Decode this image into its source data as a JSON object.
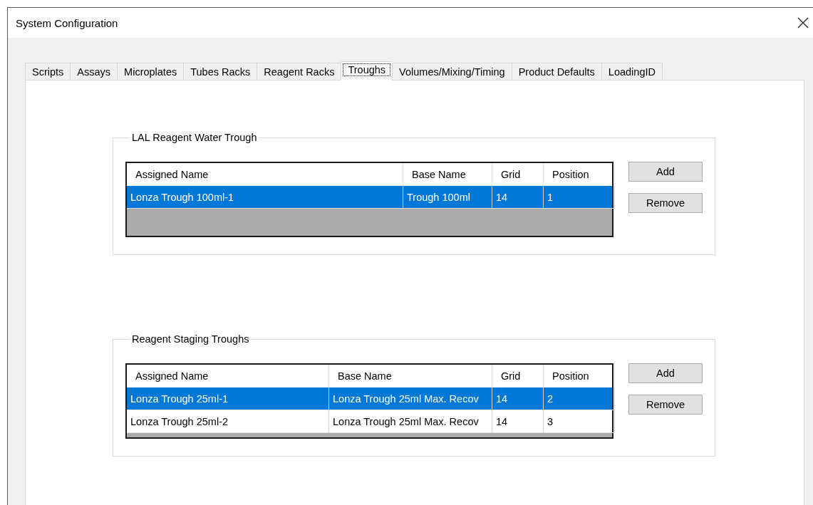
{
  "window": {
    "title": "System Configuration"
  },
  "tabs": [
    {
      "label": "Scripts",
      "selected": false
    },
    {
      "label": "Assays",
      "selected": false
    },
    {
      "label": "Microplates",
      "selected": false
    },
    {
      "label": "Tubes Racks",
      "selected": false
    },
    {
      "label": "Reagent Racks",
      "selected": false
    },
    {
      "label": "Troughs",
      "selected": true
    },
    {
      "label": "Volumes/Mixing/Timing",
      "selected": false
    },
    {
      "label": "Product Defaults",
      "selected": false
    },
    {
      "label": "LoadingID",
      "selected": false
    }
  ],
  "groups": [
    {
      "title": "LAL Reagent Water Trough",
      "columns": [
        "Assigned Name",
        "Base Name",
        "Grid",
        "Position"
      ],
      "rows": [
        {
          "cells": [
            "Lonza Trough 100ml-1",
            "Trough 100ml",
            "14",
            "1"
          ],
          "selected": true
        }
      ],
      "buttons": [
        "Add",
        "Remove"
      ]
    },
    {
      "title": "Reagent Staging Troughs",
      "columns": [
        "Assigned Name",
        "Base Name",
        "Grid",
        "Position"
      ],
      "rows": [
        {
          "cells": [
            "Lonza Trough 25ml-1",
            "Lonza Trough 25ml Max. Recov",
            "14",
            "2"
          ],
          "selected": true
        },
        {
          "cells": [
            "Lonza Trough 25ml-2",
            "Lonza Trough 25ml Max. Recov",
            "14",
            "3"
          ],
          "selected": false
        }
      ],
      "buttons": [
        "Add",
        "Remove"
      ]
    }
  ]
}
